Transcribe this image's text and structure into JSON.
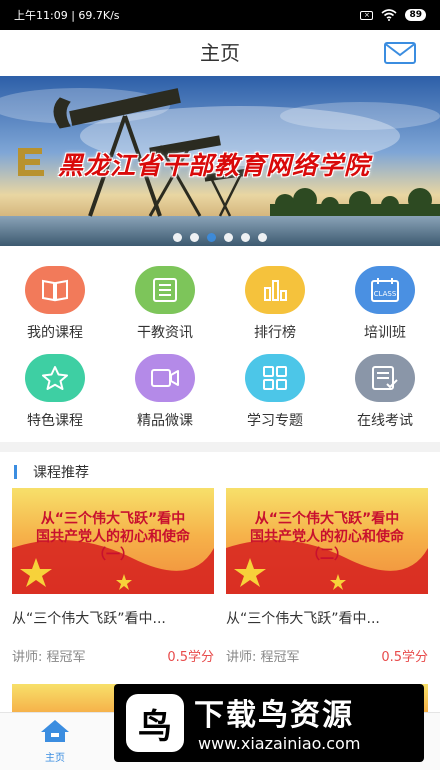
{
  "status_bar": {
    "time_speed": "上午11:09 | 69.7K/s",
    "battery": "89"
  },
  "header": {
    "title": "主页",
    "mail_icon": "mail-icon"
  },
  "banner": {
    "title": "黑龙江省干部教育网络学院",
    "slides": 6,
    "active_slide": 3
  },
  "menu": [
    {
      "label": "我的课程",
      "icon": "book-icon",
      "color": "#f27a5a"
    },
    {
      "label": "干教资讯",
      "icon": "news-icon",
      "color": "#7dc55a"
    },
    {
      "label": "排行榜",
      "icon": "bar-chart-icon",
      "color": "#f5c23c"
    },
    {
      "label": "培训班",
      "icon": "class-calendar-icon",
      "color": "#4a90e2"
    },
    {
      "label": "特色课程",
      "icon": "star-icon",
      "color": "#3ecfa3"
    },
    {
      "label": "精品微课",
      "icon": "video-icon",
      "color": "#b48ae8"
    },
    {
      "label": "学习专题",
      "icon": "grid-icon",
      "color": "#4cc6e8"
    },
    {
      "label": "在线考试",
      "icon": "exam-icon",
      "color": "#8a96a8"
    }
  ],
  "recommend": {
    "title": "课程推荐",
    "courses": [
      {
        "thumb_line1": "从“三个伟大飞跃”看中",
        "thumb_line2": "国共产党人的初心和使命",
        "thumb_line3": "（一）",
        "name": "从“三个伟大飞跃”看中...",
        "teacher": "讲师: 程冠军",
        "credit": "0.5学分"
      },
      {
        "thumb_line1": "从“三个伟大飞跃”看中",
        "thumb_line2": "国共产党人的初心和使命",
        "thumb_line3": "（二）",
        "name": "从“三个伟大飞跃”看中...",
        "teacher": "讲师: 程冠军",
        "credit": "0.5学分"
      }
    ]
  },
  "tabbar": {
    "home_label": "主页"
  },
  "watermark": {
    "logo_char": "鸟",
    "title": "下载鸟资源",
    "url": "www.xiazainiao.com"
  },
  "colors": {
    "accent": "#3b8de0",
    "credit": "#e84c4c"
  }
}
